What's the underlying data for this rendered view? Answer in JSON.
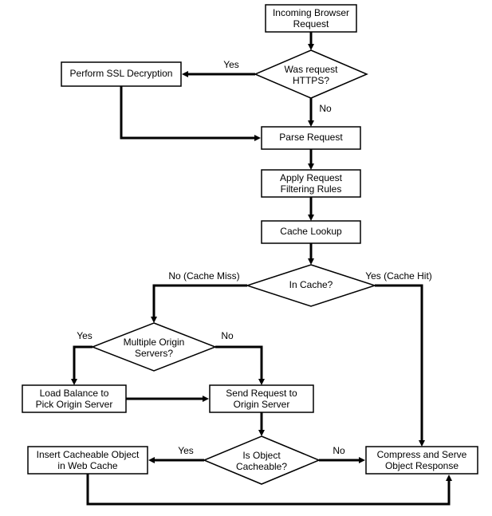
{
  "nodes": {
    "start": {
      "line1": "Incoming Browser",
      "line2": "Request"
    },
    "ssl": {
      "line1": "Perform SSL Decryption"
    },
    "https": {
      "line1": "Was request",
      "line2": "HTTPS?"
    },
    "parse": {
      "line1": "Parse Request"
    },
    "filter": {
      "line1": "Apply Request",
      "line2": "Filtering Rules"
    },
    "lookup": {
      "line1": "Cache Lookup"
    },
    "incache": {
      "line1": "In Cache?"
    },
    "multi": {
      "line1": "Multiple Origin",
      "line2": "Servers?"
    },
    "lb": {
      "line1": "Load Balance to",
      "line2": "Pick Origin Server"
    },
    "send": {
      "line1": "Send Request to",
      "line2": "Origin Server"
    },
    "cacheable": {
      "line1": "Is Object",
      "line2": "Cacheable?"
    },
    "insert": {
      "line1": "Insert Cacheable Object",
      "line2": "in Web Cache"
    },
    "serve": {
      "line1": "Compress and Serve",
      "line2": "Object Response"
    }
  },
  "edges": {
    "yes": "Yes",
    "no": "No",
    "miss": "No (Cache Miss)",
    "hit": "Yes (Cache Hit)"
  }
}
